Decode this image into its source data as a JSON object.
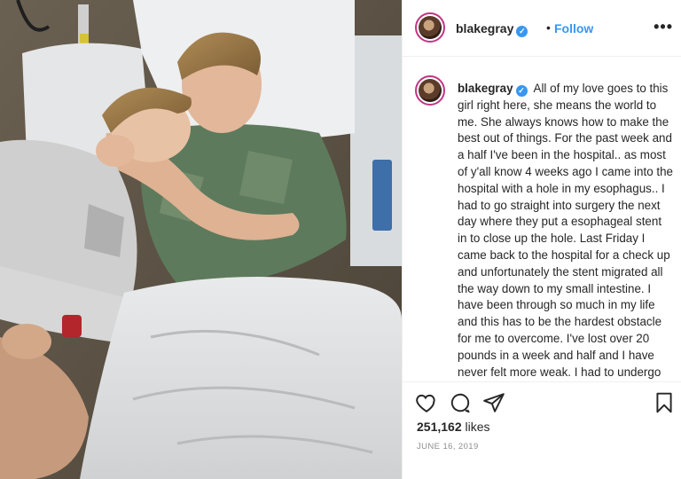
{
  "post": {
    "username": "blakegray",
    "follow_label": "Follow",
    "separator": "•",
    "more_label": "•••",
    "verified_mark": "✓",
    "caption": "All of my love goes to this girl right here, she means the world to me. She always knows how to make the best out of things. For the past week and a half I've been in the hospital.. as most of y'all know 4 weeks ago I came into the hospital with a hole in my esophagus.. I had to go straight into surgery the next day where they put a esophageal stent in to close up the hole. Last Friday I came back to the hospital for a check up and unfortunately the stent migrated all the way down to my small intestine. I have been through so much in my life and this has to be the hardest obstacle for me to overcome. I've lost over 20 pounds in a week and half and I have never felt more weak. I had to undergo two surgeries and",
    "likes_count": "251,162",
    "likes_label": "likes",
    "date": "JUNE 16, 2019"
  },
  "icons": {
    "like": "heart-icon",
    "comment": "comment-icon",
    "share": "share-icon",
    "save": "bookmark-icon",
    "verified": "verified-badge-icon"
  },
  "colors": {
    "accent": "#3897f0",
    "text": "#262626",
    "muted": "#8e8e8e",
    "border": "#efefef"
  }
}
